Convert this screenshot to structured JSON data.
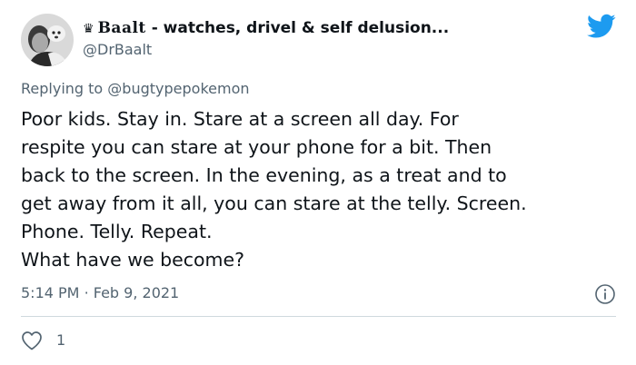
{
  "author": {
    "crown_glyph": "♛",
    "display_name": "Baalt",
    "display_name_suffix": "- watches, drivel & self delusion...",
    "handle": "@DrBaalt"
  },
  "reply": {
    "prefix": "Replying to",
    "to_handle": "@bugtypepokemon"
  },
  "tweet": {
    "text": "Poor kids. Stay in. Stare at a screen all day. For\nrespite you can stare at your phone for a bit. Then\nback to the screen. In the evening, as a treat and to\nget away from it all, you can stare at the telly. Screen.\nPhone. Telly. Repeat.\nWhat have we become?",
    "time": "5:14 PM",
    "separator": "·",
    "date": "Feb 9, 2021"
  },
  "actions": {
    "like_count": "1"
  },
  "icons": {
    "brand": "twitter-bird-icon",
    "info": "info-icon",
    "like": "heart-icon"
  },
  "colors": {
    "twitter_blue": "#1d9bf0",
    "text_primary": "#0f1419",
    "text_secondary": "#536471",
    "divider": "#cfd9de"
  }
}
